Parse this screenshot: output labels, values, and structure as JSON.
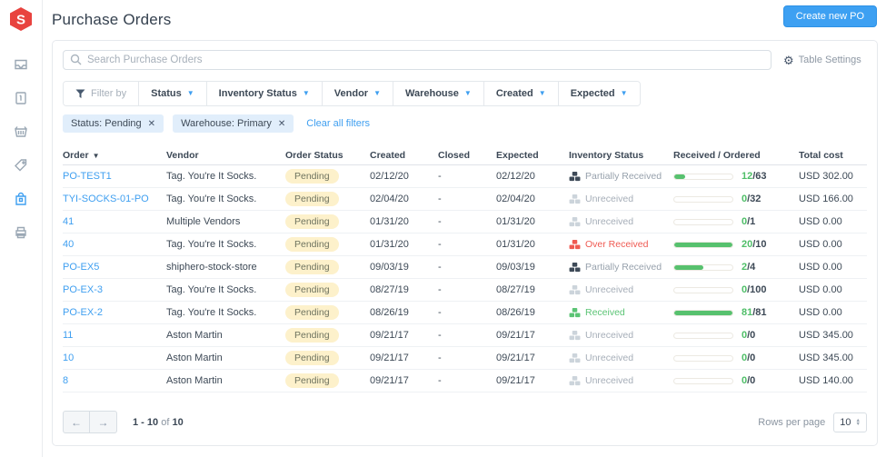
{
  "app": {
    "title": "Purchase Orders",
    "create_button_label": "Create new PO",
    "logo_icon": "shiphero-hexagon-s",
    "logo_color": "#e8433f"
  },
  "sidebar": {
    "icons": [
      "inbox-tray",
      "invoice",
      "basket",
      "tag",
      "shopping-bag",
      "printer"
    ],
    "active_icon": "shopping-bag"
  },
  "toolbar": {
    "search_placeholder": "Search Purchase Orders",
    "table_settings_label": "Table Settings",
    "gear_icon": "⚙"
  },
  "filters": {
    "filter_by_label": "Filter by",
    "dropdowns": [
      "Status",
      "Inventory Status",
      "Vendor",
      "Warehouse",
      "Created",
      "Expected"
    ],
    "active_chips": [
      "Status: Pending",
      "Warehouse: Primary"
    ],
    "chip_close_glyph": "✕",
    "clear_all_label": "Clear all filters"
  },
  "table": {
    "columns": [
      "Order",
      "Vendor",
      "Order Status",
      "Created",
      "Closed",
      "Expected",
      "Inventory Status",
      "Received / Ordered",
      "Total cost"
    ],
    "rows": [
      {
        "order": "PO-TEST1",
        "vendor": "Tag. You're It Socks.",
        "status": "Pending",
        "created": "02/12/20",
        "closed": "-",
        "expected": "02/12/20",
        "inventory_status": "Partially Received",
        "inventory_state": "partial",
        "received": 12,
        "ordered": 63,
        "total": "USD 302.00"
      },
      {
        "order": "TYI-SOCKS-01-PO",
        "vendor": "Tag. You're It Socks.",
        "status": "Pending",
        "created": "02/04/20",
        "closed": "-",
        "expected": "02/04/20",
        "inventory_status": "Unreceived",
        "inventory_state": "none",
        "received": 0,
        "ordered": 32,
        "total": "USD 166.00"
      },
      {
        "order": "41",
        "vendor": "Multiple Vendors",
        "status": "Pending",
        "created": "01/31/20",
        "closed": "-",
        "expected": "01/31/20",
        "inventory_status": "Unreceived",
        "inventory_state": "none",
        "received": 0,
        "ordered": 1,
        "total": "USD 0.00"
      },
      {
        "order": "40",
        "vendor": "Tag. You're It Socks.",
        "status": "Pending",
        "created": "01/31/20",
        "closed": "-",
        "expected": "01/31/20",
        "inventory_status": "Over Received",
        "inventory_state": "over",
        "received": 20,
        "ordered": 10,
        "total": "USD 0.00"
      },
      {
        "order": "PO-EX5",
        "vendor": "shiphero-stock-store",
        "status": "Pending",
        "created": "09/03/19",
        "closed": "-",
        "expected": "09/03/19",
        "inventory_status": "Partially Received",
        "inventory_state": "partial",
        "received": 2,
        "ordered": 4,
        "total": "USD 0.00"
      },
      {
        "order": "PO-EX-3",
        "vendor": "Tag. You're It Socks.",
        "status": "Pending",
        "created": "08/27/19",
        "closed": "-",
        "expected": "08/27/19",
        "inventory_status": "Unreceived",
        "inventory_state": "none",
        "received": 0,
        "ordered": 100,
        "total": "USD 0.00"
      },
      {
        "order": "PO-EX-2",
        "vendor": "Tag. You're It Socks.",
        "status": "Pending",
        "created": "08/26/19",
        "closed": "-",
        "expected": "08/26/19",
        "inventory_status": "Received",
        "inventory_state": "full",
        "received": 81,
        "ordered": 81,
        "total": "USD 0.00"
      },
      {
        "order": "11",
        "vendor": "Aston Martin",
        "status": "Pending",
        "created": "09/21/17",
        "closed": "-",
        "expected": "09/21/17",
        "inventory_status": "Unreceived",
        "inventory_state": "none",
        "received": 0,
        "ordered": 0,
        "total": "USD 345.00"
      },
      {
        "order": "10",
        "vendor": "Aston Martin",
        "status": "Pending",
        "created": "09/21/17",
        "closed": "-",
        "expected": "09/21/17",
        "inventory_status": "Unreceived",
        "inventory_state": "none",
        "received": 0,
        "ordered": 0,
        "total": "USD 345.00"
      },
      {
        "order": "8",
        "vendor": "Aston Martin",
        "status": "Pending",
        "created": "09/21/17",
        "closed": "-",
        "expected": "09/21/17",
        "inventory_status": "Unreceived",
        "inventory_state": "none",
        "received": 0,
        "ordered": 0,
        "total": "USD 140.00"
      }
    ]
  },
  "pagination": {
    "prev_glyph": "←",
    "next_glyph": "→",
    "range": "1 - 10",
    "of_label": "of",
    "total": "10",
    "rows_per_page_label": "Rows per page",
    "rows_per_page_value": "10"
  },
  "colors": {
    "accent_blue": "#3f9ff0",
    "progress_green": "#57c16e",
    "over_received_red": "#ef5a52",
    "pending_badge_bg": "#fdf1cb",
    "chip_bg": "#e1eefb",
    "logo_red": "#e8433f"
  }
}
